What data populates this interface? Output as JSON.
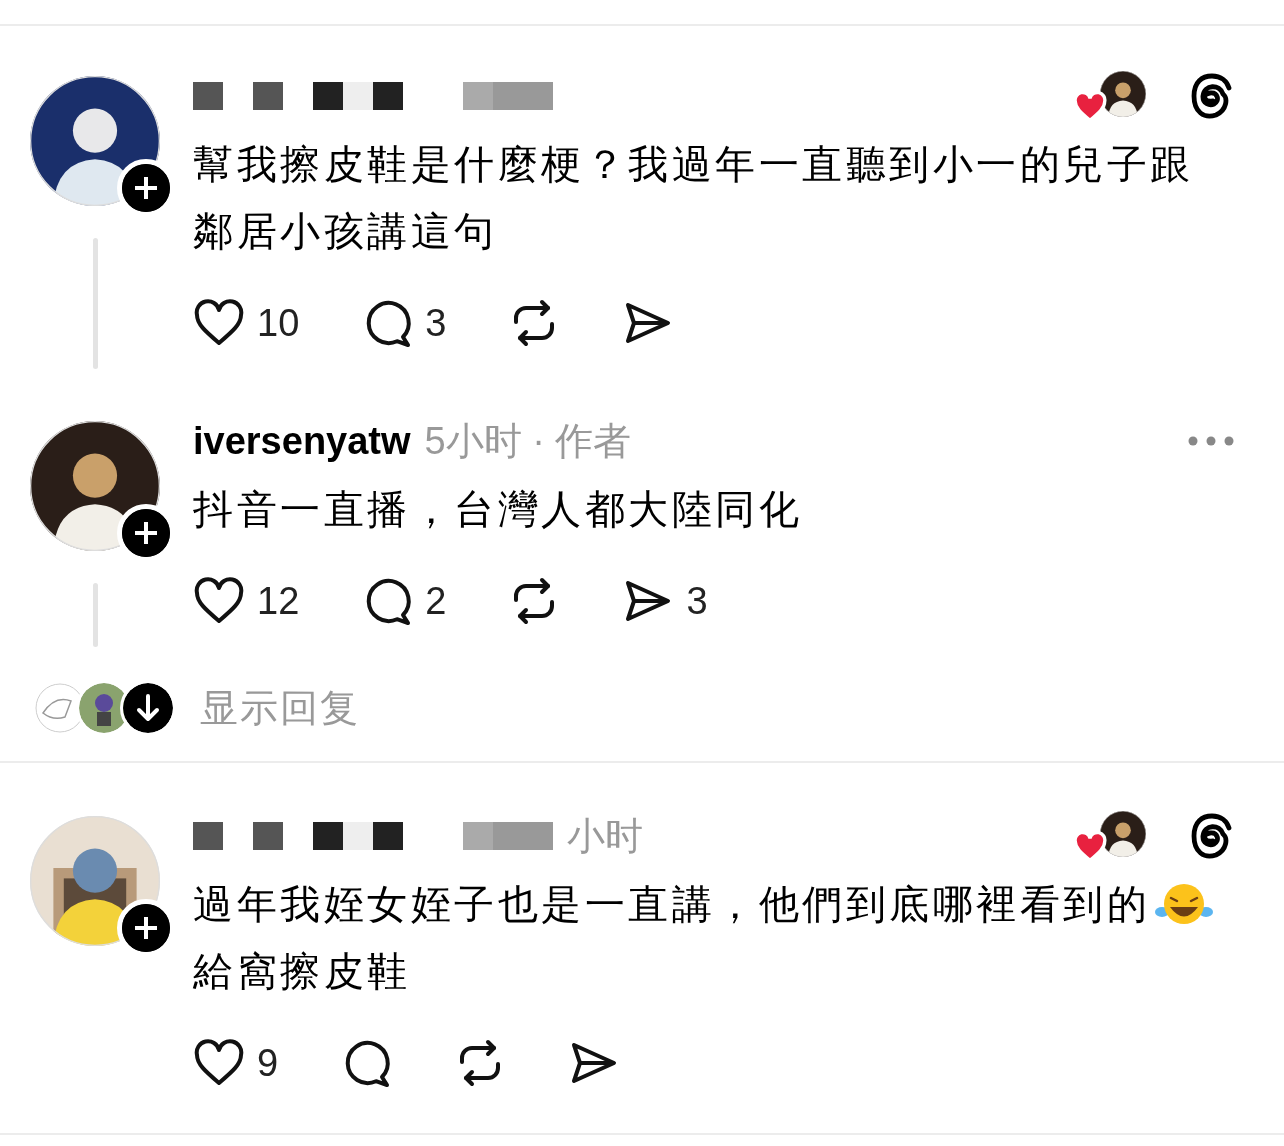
{
  "sections": [
    {
      "posts": [
        {
          "redacted": true,
          "author_liked": true,
          "corner": {
            "kind": "logo"
          },
          "thread_line": true,
          "lines": [
            "幫我擦皮鞋是什麼梗？我過年一直聽到小一的兒子跟",
            "鄰居小孩講這句"
          ],
          "actions": [
            {
              "kind": "like",
              "count": "10"
            },
            {
              "kind": "reply",
              "count": "3"
            },
            {
              "kind": "repost"
            },
            {
              "kind": "share"
            }
          ]
        },
        {
          "redacted": false,
          "username": "iversenyatw",
          "meta": "5小时 · 作者",
          "author_liked": false,
          "corner": {
            "kind": "more"
          },
          "thread_line": true,
          "lines": [
            "抖音一直播，台灣人都大陸同化"
          ],
          "actions": [
            {
              "kind": "like",
              "count": "12"
            },
            {
              "kind": "reply",
              "count": "2"
            },
            {
              "kind": "repost"
            },
            {
              "kind": "share",
              "count": "3"
            }
          ]
        }
      ],
      "show_replies": "显示回复"
    },
    {
      "posts": [
        {
          "redacted": true,
          "meta": "小时",
          "author_liked": true,
          "corner": {
            "kind": "logo"
          },
          "thread_line": false,
          "lines": [
            "過年我姪女姪子也是一直講，他們到底哪裡看到的",
            "給窩擦皮鞋"
          ],
          "emoji": {
            "kind": "laughing"
          },
          "actions": [
            {
              "kind": "like",
              "count": "9"
            },
            {
              "kind": "reply"
            },
            {
              "kind": "repost"
            },
            {
              "kind": "share"
            }
          ]
        }
      ]
    }
  ]
}
